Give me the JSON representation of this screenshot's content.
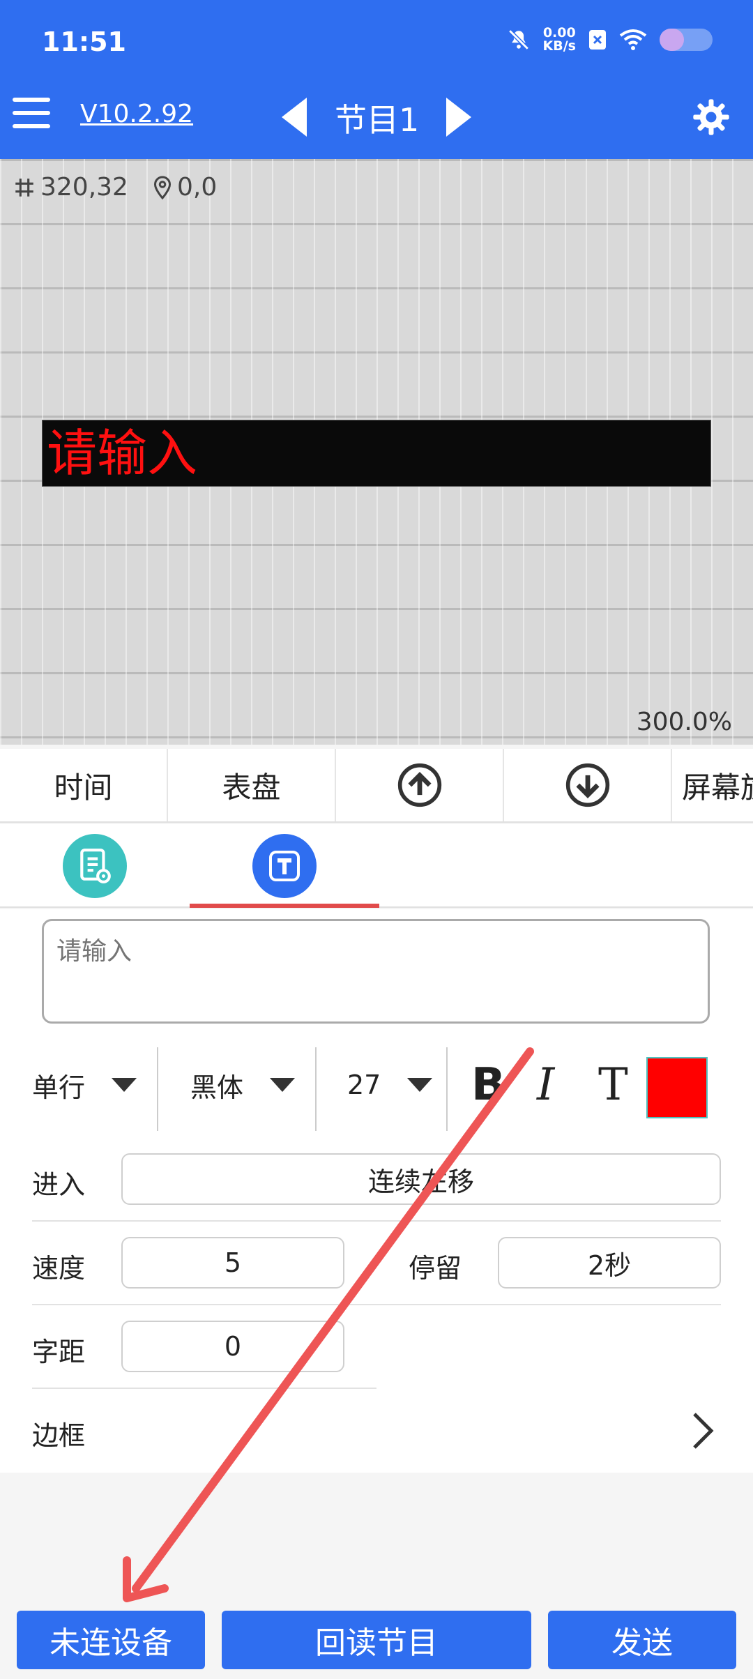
{
  "status_bar": {
    "time": "11:51",
    "net_speed_value": "0.00",
    "net_speed_unit": "KB/s",
    "icons": [
      "mute-bell-icon",
      "close-box-icon",
      "wifi-icon",
      "battery-icon"
    ]
  },
  "header": {
    "version": "V10.2.92",
    "program_title": "节目1"
  },
  "canvas": {
    "size_readout": "320,32",
    "position_readout": "0,0",
    "led_text": "请输入",
    "led_text_color": "#ff1010",
    "zoom": "300.0%"
  },
  "toolbar": {
    "items": [
      "时间",
      "表盘",
      "上移",
      "下移",
      "屏幕旋"
    ]
  },
  "tabs": {
    "active": "text"
  },
  "text_props": {
    "placeholder": "请输入",
    "line_mode": "单行",
    "font": "黑体",
    "size": "27",
    "bold_label": "B",
    "italic_label": "I",
    "t_label": "T",
    "color": "#ff0000",
    "enter_label": "进入",
    "enter_value": "连续左移",
    "speed_label": "速度",
    "speed_value": "5",
    "stay_label": "停留",
    "stay_value": "2秒",
    "spacing_label": "字距",
    "spacing_value": "0",
    "border_label": "边框"
  },
  "bottom_buttons": {
    "device": "未连设备",
    "readback": "回读节目",
    "send": "发送"
  },
  "colors": {
    "primary": "#2f6ef0",
    "teal": "#3cc2c0",
    "tab_underline": "#e14b4b",
    "annotation_arrow": "#ee5555"
  }
}
